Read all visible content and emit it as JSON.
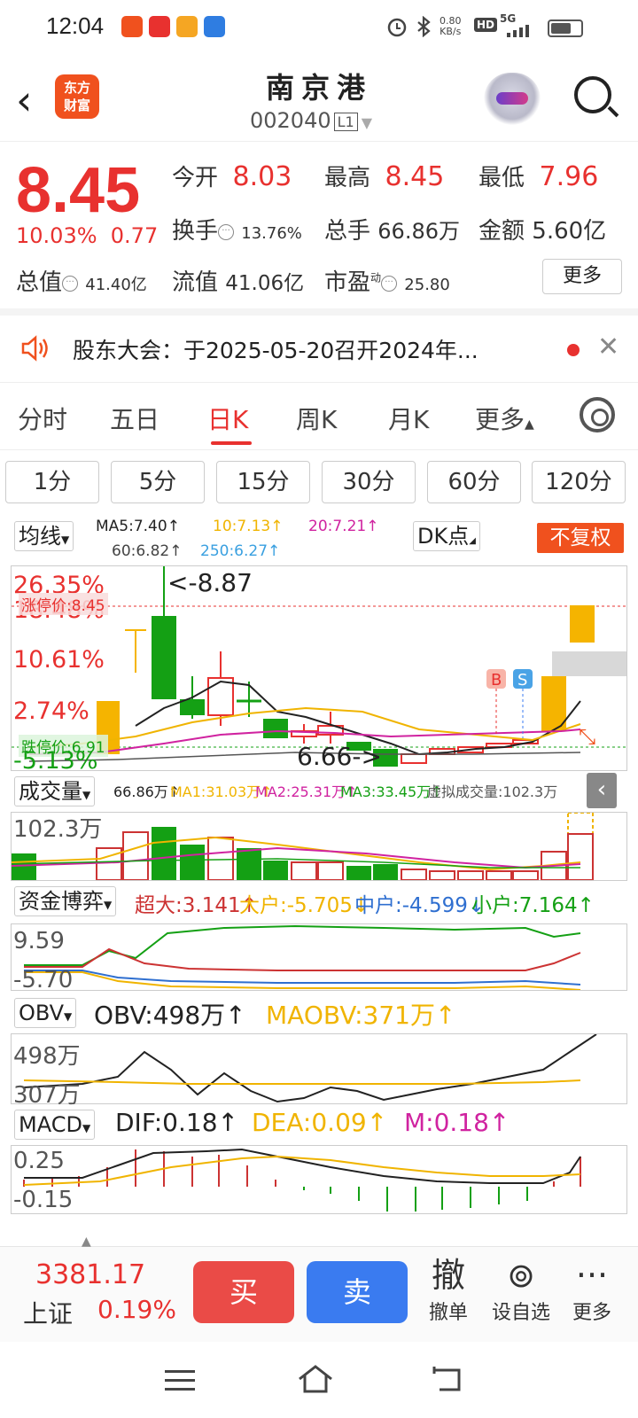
{
  "status_bar": {
    "time": "12:04",
    "net_speed": "0.80\nKB/s",
    "hd": "HD",
    "signal": "5G"
  },
  "header": {
    "app_logo_text": "东方\n财富",
    "stock_name": "南京港",
    "stock_code": "002040",
    "level": "L1"
  },
  "quote": {
    "price": "8.45",
    "change_pct": "10.03%",
    "change_amt": "0.77",
    "open_label": "今开",
    "open": "8.03",
    "high_label": "最高",
    "high": "8.45",
    "low_label": "最低",
    "low": "7.96",
    "turnover_label": "换手",
    "turnover": "13.76%",
    "volume_label": "总手",
    "volume": "66.86万",
    "amount_label": "金额",
    "amount": "5.60亿",
    "mktcap_label": "总值",
    "mktcap": "41.40亿",
    "float_label": "流值",
    "float": "41.06亿",
    "pe_label": "市盈",
    "pe_sup": "动",
    "pe": "25.80",
    "more": "更多"
  },
  "notice": {
    "text": "股东大会：于2025-05-20召开2024年..."
  },
  "tabs": [
    "分时",
    "五日",
    "日K",
    "周K",
    "月K",
    "更多"
  ],
  "active_tab": "日K",
  "periods": [
    "1分",
    "5分",
    "15分",
    "30分",
    "60分",
    "120分"
  ],
  "kline": {
    "indicator": "均线",
    "ma5": "MA5:7.40↑",
    "ma10": "10:7.13↑",
    "ma20": "20:7.21↑",
    "ma60": "60:6.82↑",
    "ma250": "250:6.27↑",
    "dk": "DK点",
    "adjust": "不复权",
    "pct_labels": [
      "26.35%",
      "18.48%",
      "10.61%",
      "2.74%",
      "-5.13%"
    ],
    "limit_up": "涨停价:8.45",
    "limit_down": "跌停价:6.91",
    "high_mark": "<-8.87",
    "low_mark": "6.66->",
    "b_label": "B",
    "s_label": "S",
    "colors": {
      "up": "#e8312f",
      "down": "#14a014",
      "ma5": "#222222",
      "ma10": "#f0b400",
      "ma20": "#d023a0",
      "ma60": "#555555",
      "ma250": "#3aa0e0"
    }
  },
  "volume": {
    "indicator": "成交量",
    "vol": "66.86万↑",
    "ma1": "MA1:31.03万↑",
    "ma2": "MA2:25.31万↑",
    "ma3": "MA3:33.45万↑",
    "virtual": "虚拟成交量:102.3万",
    "axis_top": "102.3万"
  },
  "fund": {
    "indicator": "资金博弈",
    "super": "超大:3.141↑",
    "large": "大户:-5.705↓",
    "medium": "中户:-4.599↓",
    "small": "小户:7.164↑",
    "axis_top": "9.59",
    "axis_bottom": "-5.70"
  },
  "obv": {
    "indicator": "OBV",
    "obv": "OBV:498万↑",
    "maobv": "MAOBV:371万↑",
    "axis_top": "498万",
    "axis_bottom": "307万"
  },
  "macd": {
    "indicator": "MACD",
    "dif": "DIF:0.18↑",
    "dea": "DEA:0.09↑",
    "m": "M:0.18↑",
    "axis_top": "0.25",
    "axis_bottom": "-0.15"
  },
  "bottom": {
    "index_value": "3381.17",
    "index_name": "上证",
    "index_pct": "0.19%",
    "buy": "买",
    "sell": "卖",
    "cancel_icon": "撤",
    "cancel": "撤单",
    "watch": "设自选",
    "more": "更多"
  }
}
